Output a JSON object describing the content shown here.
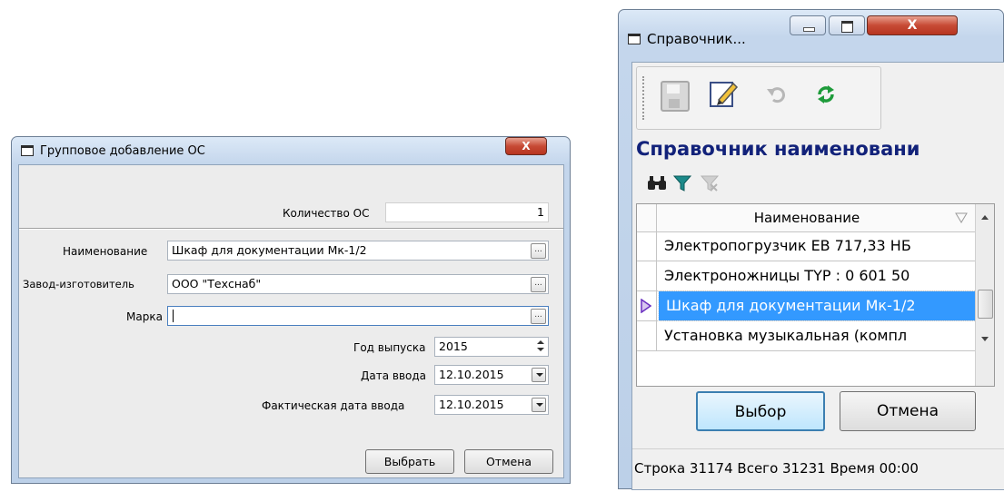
{
  "dialog": {
    "title": "Групповое добавление ОС",
    "close_glyph": "X",
    "count_label": "Количество ОС",
    "count_value": "1",
    "name_label": "Наименование",
    "name_value": "Шкаф для документации Мк-1/2",
    "maker_label": "Завод-изготовитель",
    "maker_value": "ООО \"Техснаб\"",
    "brand_label": "Марка",
    "brand_value": "",
    "ellipsis": "...",
    "year_label": "Год выпуска",
    "year_value": "2015",
    "date_label": "Дата ввода",
    "date_value": "12.10.2015",
    "actual_date_label": "Фактическая дата ввода",
    "actual_date_value": "12.10.2015",
    "select_button": "Выбрать",
    "cancel_button": "Отмена"
  },
  "ref": {
    "title": "Справочник...",
    "close_glyph": "X",
    "heading": "Справочник наименовани",
    "column_header": "Наименование",
    "rows": [
      "Электропогрузчик ЕВ 717,33 НБ",
      "Электроножницы TYP : 0 601 50",
      "Шкаф для документации Мк-1/2",
      "Установка музыкальная (компл"
    ],
    "selected_row": 2,
    "select_button": "Выбор",
    "cancel_button": "Отмена",
    "status": "Строка 31174 Всего 31231 Время 00:00"
  },
  "colors": {
    "selection": "#3399ff",
    "heading": "#12227a",
    "title_gradient_top": "#dce9f7"
  }
}
